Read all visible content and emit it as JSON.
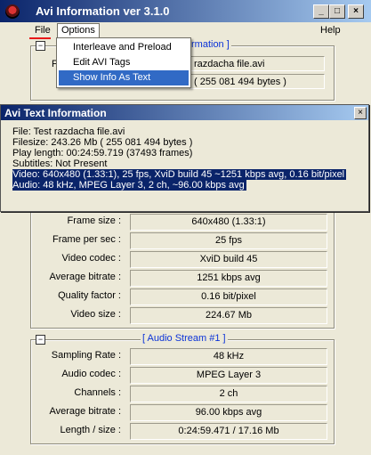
{
  "window": {
    "title": "Avi Information ver 3.1.0",
    "minimize_label": "_",
    "maximize_label": "□",
    "close_label": "×"
  },
  "menu": {
    "file": "File",
    "options": "Options",
    "help": "Help"
  },
  "dropdown": {
    "items": [
      {
        "label": "Interleave and Preload"
      },
      {
        "label": "Edit AVI Tags"
      },
      {
        "label": "Show Info As Text",
        "selected": true
      }
    ]
  },
  "file_section": {
    "title_fragment": "rmation ]",
    "label_fragment": "F",
    "filename_fragment": "razdacha file.avi",
    "filesize_fragment": "( 255 081 494 bytes )"
  },
  "text_window": {
    "title": "Avi Text Information",
    "close_label": "×",
    "lines": [
      "File: Test razdacha file.avi",
      "Filesize: 243.26 Mb ( 255 081 494 bytes )",
      "Play length: 00:24:59.719 (37493 frames)",
      "Subtitles: Not Present",
      "Video: 640x480 (1.33:1), 25 fps, XviD build 45 ~1251 kbps avg, 0.16 bit/pixel",
      "Audio: 48 kHz, MPEG Layer 3, 2 ch, ~96.00 kbps avg"
    ]
  },
  "video_stream": {
    "rows": [
      {
        "label": "Frame size :",
        "value": "640x480 (1.33:1)"
      },
      {
        "label": "Frame per sec :",
        "value": "25 fps"
      },
      {
        "label": "Video codec :",
        "value": "XviD build 45"
      },
      {
        "label": "Average bitrate :",
        "value": "1251 kbps avg"
      },
      {
        "label": "Quality factor :",
        "value": "0.16 bit/pixel"
      },
      {
        "label": "Video size :",
        "value": "224.67 Mb"
      }
    ]
  },
  "audio_stream": {
    "title": "[ Audio Stream #1 ]",
    "collapse_label": "−",
    "rows": [
      {
        "label": "Sampling Rate :",
        "value": "48 kHz"
      },
      {
        "label": "Audio codec :",
        "value": "MPEG Layer 3"
      },
      {
        "label": "Channels :",
        "value": "2 ch"
      },
      {
        "label": "Average bitrate :",
        "value": "96.00 kbps avg"
      },
      {
        "label": "Length / size :",
        "value": "0:24:59.471 / 17.16 Mb"
      }
    ]
  },
  "colors": {
    "title_bar_start": "#0a246a",
    "title_bar_end": "#a6caf0",
    "menu_highlight": "#316ac5",
    "section_title": "#0b33d8",
    "file_underline": "#e81818"
  }
}
